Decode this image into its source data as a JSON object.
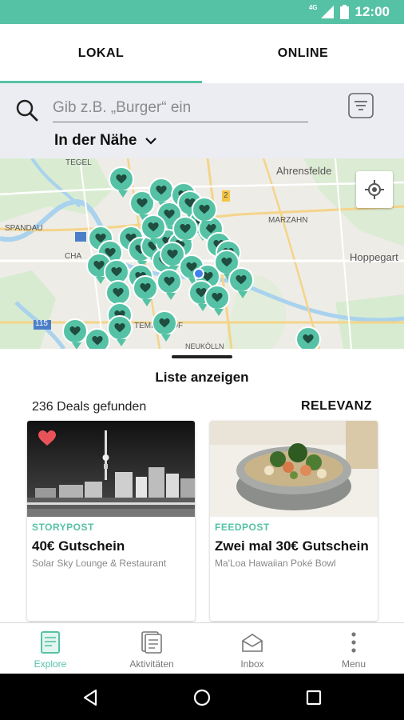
{
  "status": {
    "network": "4G",
    "time": "12:00"
  },
  "tabs": [
    {
      "label": "LOKAL"
    },
    {
      "label": "ONLINE"
    }
  ],
  "search": {
    "placeholder": "Gib z.B. „Burger“ ein",
    "value": ""
  },
  "location": {
    "label": "In der Nähe"
  },
  "map": {
    "labels": {
      "tegel": "TEGEL",
      "ahrensfelde": "Ahrensfelde",
      "spandau": "SPANDAU",
      "marzahn": "MARZAHN",
      "hoppegarten": "Hoppegart",
      "tempelhof": "TEMPELHOF",
      "road_115": "115",
      "cha": "CHA",
      "neukolln": "NEUKÖLLN",
      "road_2": "2"
    }
  },
  "list": {
    "title": "Liste anzeigen",
    "count": "236 Deals gefunden",
    "sort": "RELEVANZ"
  },
  "cards": [
    {
      "type": "STORYPOST",
      "title": "40€ Gutschein",
      "subtitle": "Solar Sky Lounge & Restaurant",
      "favorite": true
    },
    {
      "type": "FEEDPOST",
      "title": "Zwei mal 30€ Gutschein",
      "subtitle": "Ma'Loa Hawaiian Poké Bowl",
      "favorite": false
    }
  ],
  "nav": [
    {
      "label": "Explore",
      "icon": "explore-icon",
      "active": true
    },
    {
      "label": "Aktivitäten",
      "icon": "activities-icon",
      "active": false
    },
    {
      "label": "Inbox",
      "icon": "inbox-icon",
      "active": false
    },
    {
      "label": "Menu",
      "icon": "menu-dots-icon",
      "active": false
    }
  ],
  "colors": {
    "accent": "#56c2a5",
    "favorite": "#e8535a",
    "user_location": "#3f80f0"
  }
}
